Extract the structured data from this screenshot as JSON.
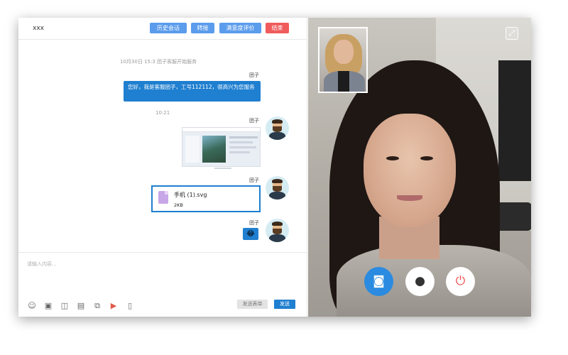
{
  "chat": {
    "title": "xxx",
    "buttons": {
      "history": "历史会话",
      "transfer": "转接",
      "rating": "满意度评价",
      "end": "结束"
    },
    "system_messages": [
      "10月30日 15:3 团子客服开始服务",
      "10:21"
    ],
    "messages": [
      {
        "sender": "团子",
        "type": "text",
        "text": "您好，我是客服团子，工号112112，很高兴为您服务"
      },
      {
        "sender": "团子",
        "type": "image"
      },
      {
        "sender": "团子",
        "type": "file",
        "file_name": "手机 (1).svg",
        "file_size": "2KB"
      },
      {
        "sender": "团子",
        "type": "emoji",
        "emoji": "😂"
      }
    ],
    "input": {
      "placeholder": "请输入内容...",
      "send_form_label": "发送表单",
      "send_label": "发送"
    },
    "toolbar_icons": [
      "emoji-icon",
      "image-icon",
      "briefcase-icon",
      "document-icon",
      "copy-icon",
      "video-call-icon",
      "file-icon"
    ]
  },
  "video": {
    "controls": [
      "camera-icon",
      "microphone-icon",
      "power-icon"
    ],
    "colors": {
      "camera_button": "#2a8be0",
      "hangup": "#ef4a4a"
    }
  },
  "colors": {
    "primary_button": "#5b9cec",
    "end_button": "#f05b5b",
    "bubble": "#1f7fd0"
  }
}
